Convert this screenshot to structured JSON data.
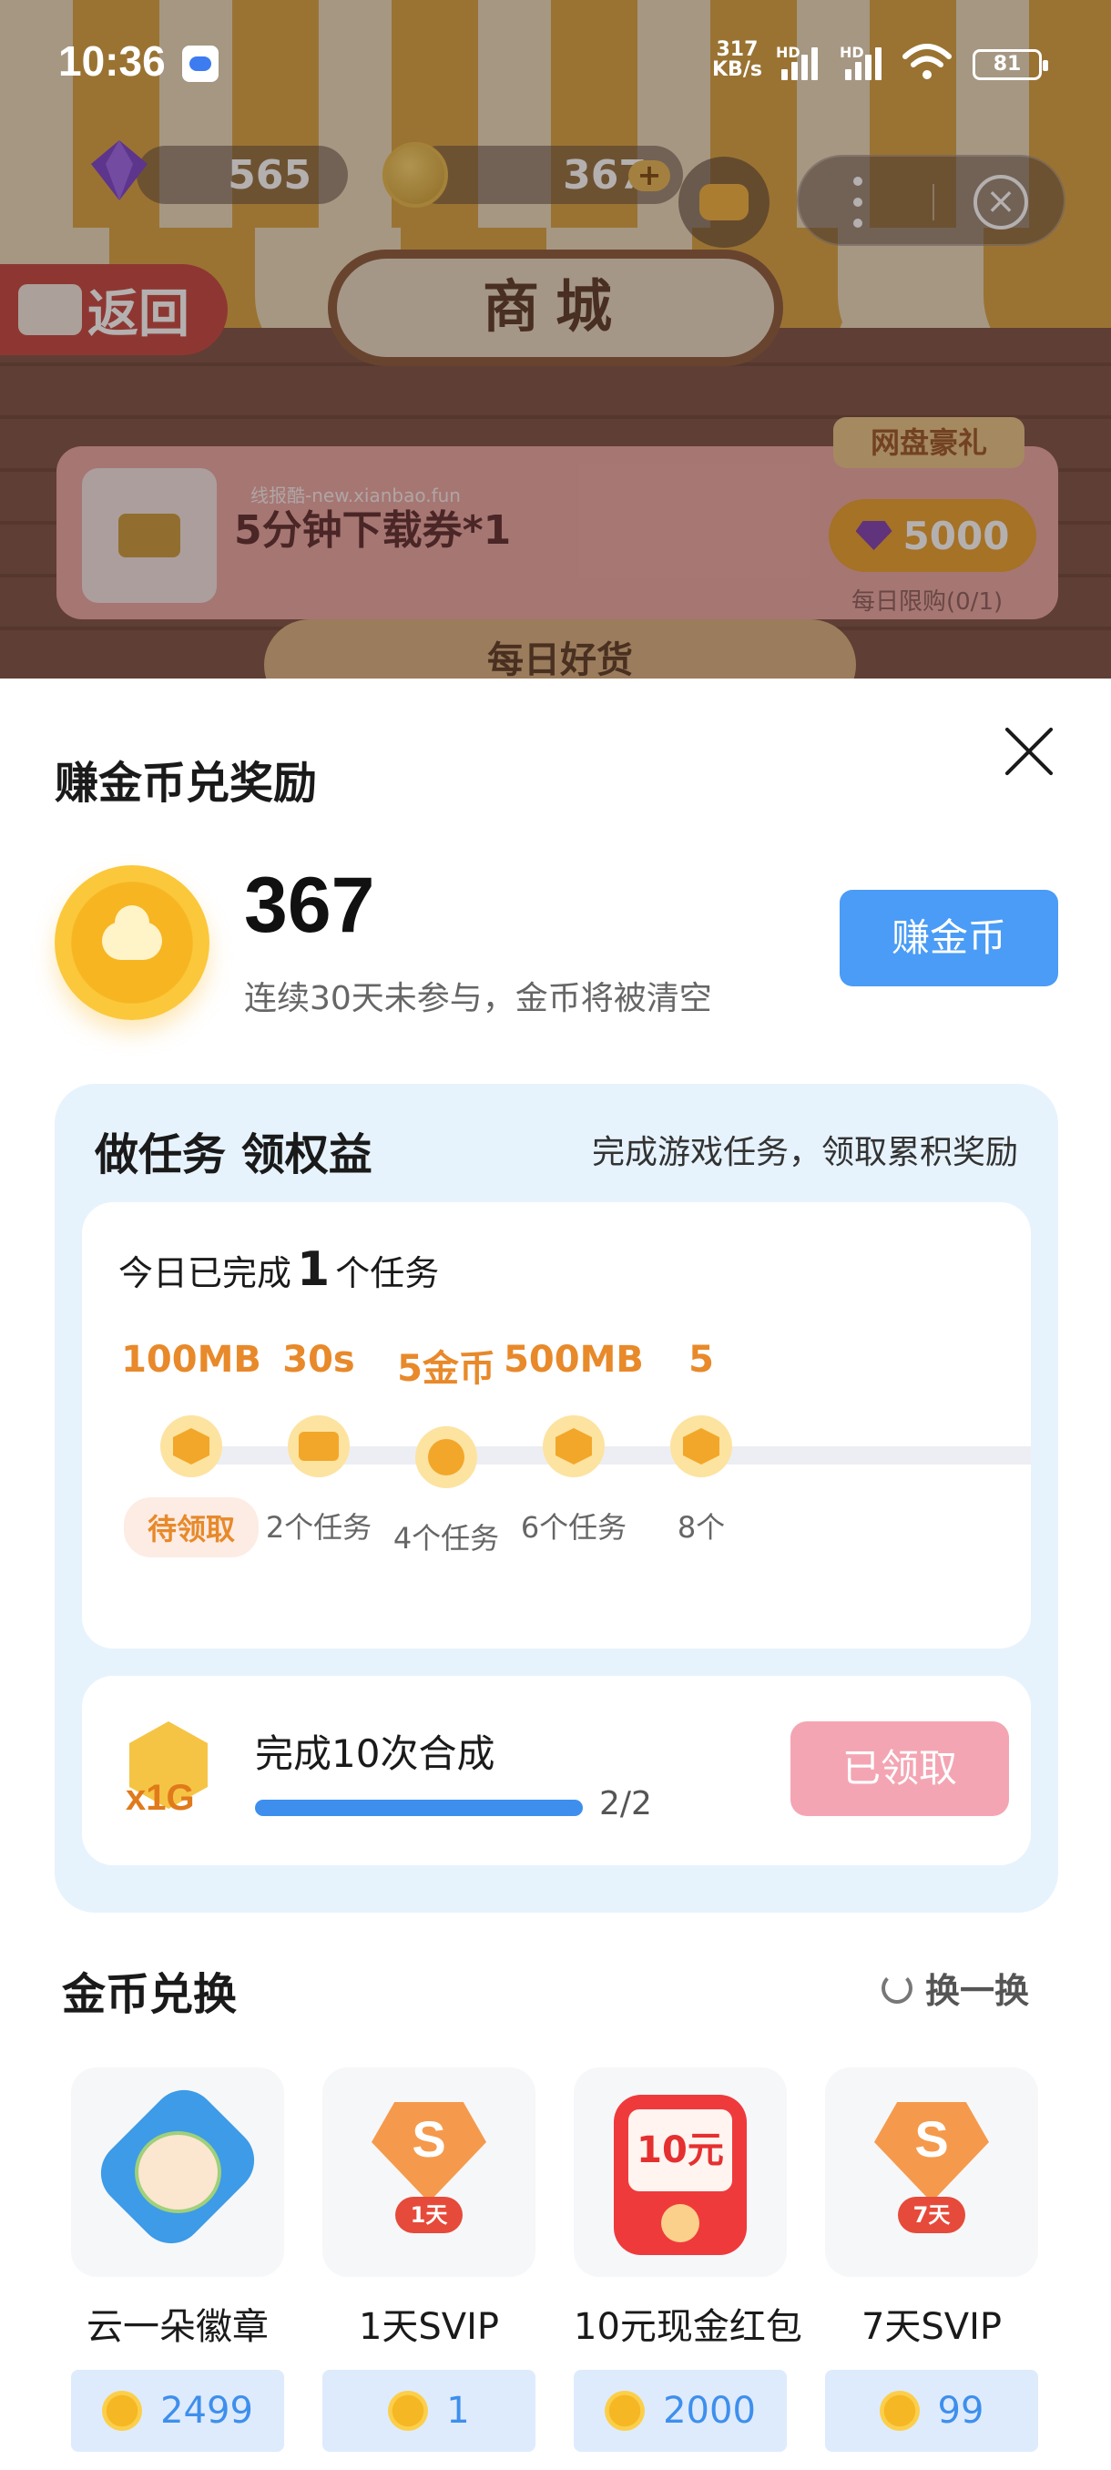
{
  "status_bar": {
    "time": "10:36",
    "net_speed_value": "317",
    "net_speed_unit": "KB/s",
    "signal_label_1": "HD",
    "signal_label_2": "HD",
    "battery": "81"
  },
  "game": {
    "gems": "565",
    "coins": "367",
    "back_label": "返回",
    "shop_title": "商城",
    "featured": {
      "tag": "网盘豪礼",
      "name": "5分钟下载券*1",
      "price": "5000",
      "limit": "每日限购(0/1)",
      "watermark": "线报酷-new.xianbao.fun"
    },
    "next_tab": "每日好货"
  },
  "sheet": {
    "title": "赚金币兑奖励",
    "coin_balance": "367",
    "coin_note": "连续30天未参与，金币将被清空",
    "earn_button": "赚金币",
    "tasks": {
      "title": "做任务 领权益",
      "subtitle": "完成游戏任务，领取累积奖励",
      "done_prefix": "今日已完成",
      "done_count": "1",
      "done_suffix": "个任务",
      "steps": [
        {
          "reward": "100MB",
          "requirement": "待领取",
          "claimable": true
        },
        {
          "reward": "30s",
          "requirement": "2个任务",
          "claimable": false
        },
        {
          "reward": "5金币",
          "requirement": "4个任务",
          "claimable": false
        },
        {
          "reward": "500MB",
          "requirement": "6个任务",
          "claimable": false
        },
        {
          "reward": "5",
          "requirement": "8个",
          "claimable": false
        }
      ],
      "mission": {
        "icon_label": "x1G",
        "name": "完成10次合成",
        "progress_text": "2/2",
        "progress": 1.0,
        "button": "已领取"
      }
    },
    "exchange": {
      "title": "金币兑换",
      "refresh_label": "换一换",
      "items": [
        {
          "name": "云一朵徽章",
          "cost": "2499"
        },
        {
          "name": "1天SVIP",
          "cost": "1",
          "badge": "1天",
          "mark": "S"
        },
        {
          "name": "10元现金红包",
          "cost": "2000",
          "amount": "10元"
        },
        {
          "name": "7天SVIP",
          "cost": "99",
          "badge": "7天",
          "mark": "S"
        }
      ]
    }
  }
}
